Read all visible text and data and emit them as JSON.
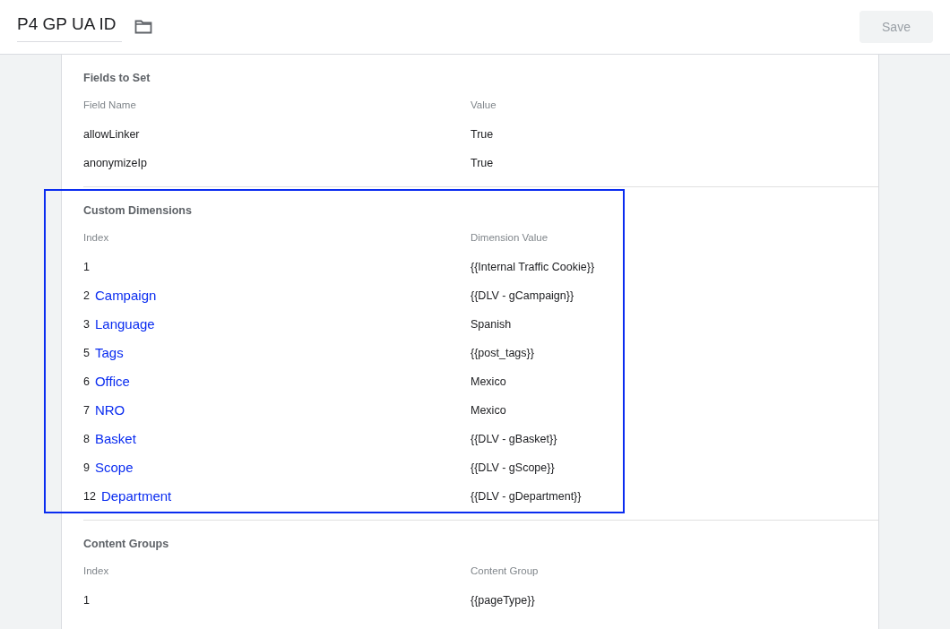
{
  "header": {
    "title": "P4 GP UA ID",
    "save_button": "Save",
    "save_disabled": true
  },
  "sections": [
    {
      "title": "Fields to Set",
      "highlighted": false,
      "columns": [
        "Field Name",
        "Value"
      ],
      "rows": [
        {
          "name": "allowLinker",
          "value": "True"
        },
        {
          "name": "anonymizeIp",
          "value": "True"
        }
      ]
    },
    {
      "title": "Custom Dimensions",
      "highlighted": true,
      "columns": [
        "Index",
        "Dimension Value"
      ],
      "rows": [
        {
          "name": "1",
          "value": "{{Internal Traffic Cookie}}"
        },
        {
          "name": "2",
          "annotation": "Campaign",
          "value": "{{DLV - gCampaign}}"
        },
        {
          "name": "3",
          "annotation": "Language",
          "value": "Spanish"
        },
        {
          "name": "5",
          "annotation": "Tags",
          "value": "{{post_tags}}"
        },
        {
          "name": "6",
          "annotation": "Office",
          "value": "Mexico"
        },
        {
          "name": "7",
          "annotation": "NRO",
          "value": "Mexico"
        },
        {
          "name": "8",
          "annotation": "Basket",
          "value": "{{DLV - gBasket}}"
        },
        {
          "name": "9",
          "annotation": "Scope",
          "value": "{{DLV - gScope}}"
        },
        {
          "name": "12",
          "annotation": "Department",
          "value": "{{DLV - gDepartment}}"
        }
      ]
    },
    {
      "title": "Content Groups",
      "highlighted": false,
      "columns": [
        "Index",
        "Content Group"
      ],
      "rows": [
        {
          "name": "1",
          "value": "{{pageType}}"
        }
      ]
    }
  ]
}
